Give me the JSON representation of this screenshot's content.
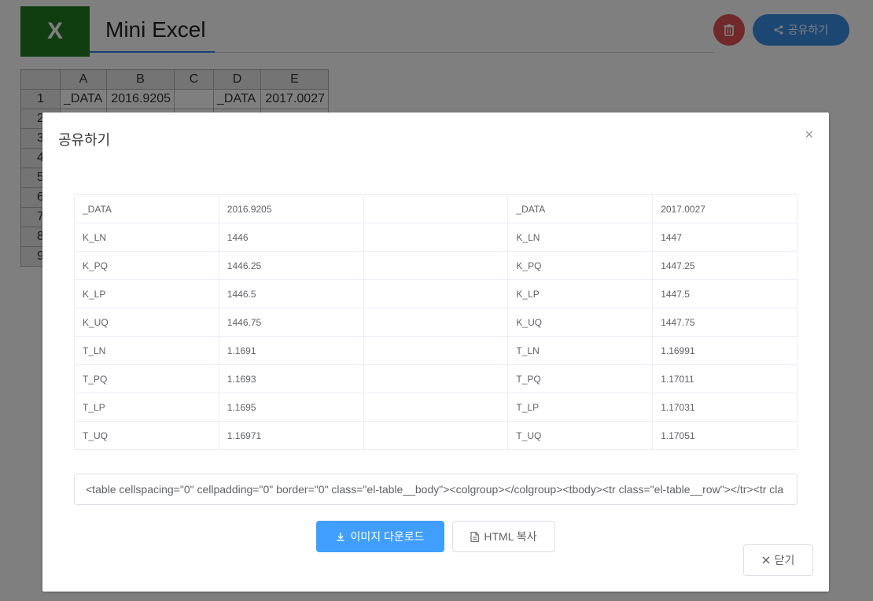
{
  "app": {
    "logo_letter": "X",
    "title": "Mini Excel",
    "share_button_label": "공유하기",
    "accent_color": "#2f80ed",
    "logo_color": "#1f7a1f"
  },
  "sheet": {
    "columns": [
      "A",
      "B",
      "C",
      "D",
      "E"
    ],
    "rows": [
      {
        "num": "1",
        "cells": [
          "_DATA",
          "2016.9205",
          "",
          "_DATA",
          "2017.0027"
        ]
      },
      {
        "num": "2",
        "cells": [
          "",
          "",
          "",
          "",
          ""
        ]
      },
      {
        "num": "3",
        "cells": [
          "",
          "",
          "",
          "",
          ""
        ]
      },
      {
        "num": "4",
        "cells": [
          "",
          "",
          "",
          "",
          ""
        ]
      },
      {
        "num": "5",
        "cells": [
          "",
          "",
          "",
          "",
          ""
        ]
      },
      {
        "num": "6",
        "cells": [
          "",
          "",
          "",
          "",
          ""
        ]
      },
      {
        "num": "7",
        "cells": [
          "",
          "",
          "",
          "",
          ""
        ]
      },
      {
        "num": "8",
        "cells": [
          "",
          "",
          "",
          "",
          ""
        ]
      },
      {
        "num": "9",
        "cells": [
          "",
          "",
          "",
          "",
          ""
        ]
      }
    ]
  },
  "dialog": {
    "title": "공유하기",
    "close_symbol": "×",
    "table_rows": [
      [
        "_DATA",
        "2016.9205",
        "",
        "_DATA",
        "2017.0027"
      ],
      [
        "K_LN",
        "1446",
        "",
        "K_LN",
        "1447"
      ],
      [
        "K_PQ",
        "1446.25",
        "",
        "K_PQ",
        "1447.25"
      ],
      [
        "K_LP",
        "1446.5",
        "",
        "K_LP",
        "1447.5"
      ],
      [
        "K_UQ",
        "1446.75",
        "",
        "K_UQ",
        "1447.75"
      ],
      [
        "T_LN",
        "1.1691",
        "",
        "T_LN",
        "1.16991"
      ],
      [
        "T_PQ",
        "1.1693",
        "",
        "T_PQ",
        "1.17011"
      ],
      [
        "T_LP",
        "1.1695",
        "",
        "T_LP",
        "1.17031"
      ],
      [
        "T_UQ",
        "1.16971",
        "",
        "T_UQ",
        "1.17051"
      ]
    ],
    "html_code": "<table cellspacing=\"0\" cellpadding=\"0\" border=\"0\" class=\"el-table__body\"><colgroup></colgroup><tbody><tr class=\"el-table__row\"></tr><tr cla",
    "download_label": "이미지 다운로드",
    "copy_label": "HTML 복사",
    "close_label": "닫기",
    "primary_color": "#409eff"
  }
}
